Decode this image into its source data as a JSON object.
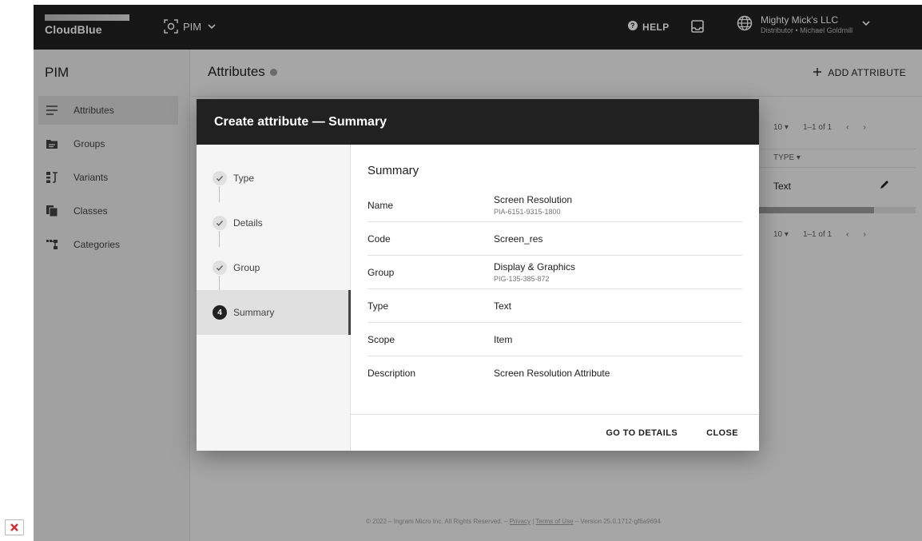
{
  "topbar": {
    "logo_text": "CloudBlue",
    "app_name": "PIM",
    "help_label": "HELP",
    "account_name": "Mighty Mick's LLC",
    "account_sub": "Distributor • Michael Goldmill"
  },
  "sidebar": {
    "title": "PIM",
    "items": [
      {
        "label": "Attributes",
        "icon": "list-icon"
      },
      {
        "label": "Groups",
        "icon": "folder-icon"
      },
      {
        "label": "Variants",
        "icon": "variants-icon"
      },
      {
        "label": "Classes",
        "icon": "copy-icon"
      },
      {
        "label": "Categories",
        "icon": "tree-icon"
      }
    ]
  },
  "main": {
    "title": "Attributes",
    "add_label": "ADD ATTRIBUTE",
    "pager_top": {
      "size": "10",
      "range": "1–1 of 1"
    },
    "type_header": "TYPE",
    "row_type": "Text",
    "pager_bottom": {
      "size": "10",
      "range": "1–1 of 1"
    }
  },
  "footer": {
    "copyright": "© 2022 – Ingram Micro Inc. All Rights Reserved. –",
    "privacy": "Privacy",
    "separator": "|",
    "terms": "Terms of Use",
    "version": "– Version 25.0.1712-gf6a9694"
  },
  "dialog": {
    "title": "Create attribute — Summary",
    "steps": [
      {
        "label": "Type",
        "status": "done"
      },
      {
        "label": "Details",
        "status": "done"
      },
      {
        "label": "Group",
        "status": "done"
      },
      {
        "label": "Summary",
        "status": "current",
        "number": "4"
      }
    ],
    "summary_title": "Summary",
    "rows": [
      {
        "label": "Name",
        "value": "Screen Resolution",
        "sub": "PIA-6151-9315-1800"
      },
      {
        "label": "Code",
        "value": "Screen_res",
        "sub": ""
      },
      {
        "label": "Group",
        "value": "Display & Graphics",
        "sub": "PIG-135-385-872"
      },
      {
        "label": "Type",
        "value": "Text",
        "sub": ""
      },
      {
        "label": "Scope",
        "value": "Item",
        "sub": ""
      },
      {
        "label": "Description",
        "value": "Screen Resolution Attribute",
        "sub": ""
      }
    ],
    "go_to_details_label": "GO TO DETAILS",
    "close_label": "CLOSE"
  }
}
